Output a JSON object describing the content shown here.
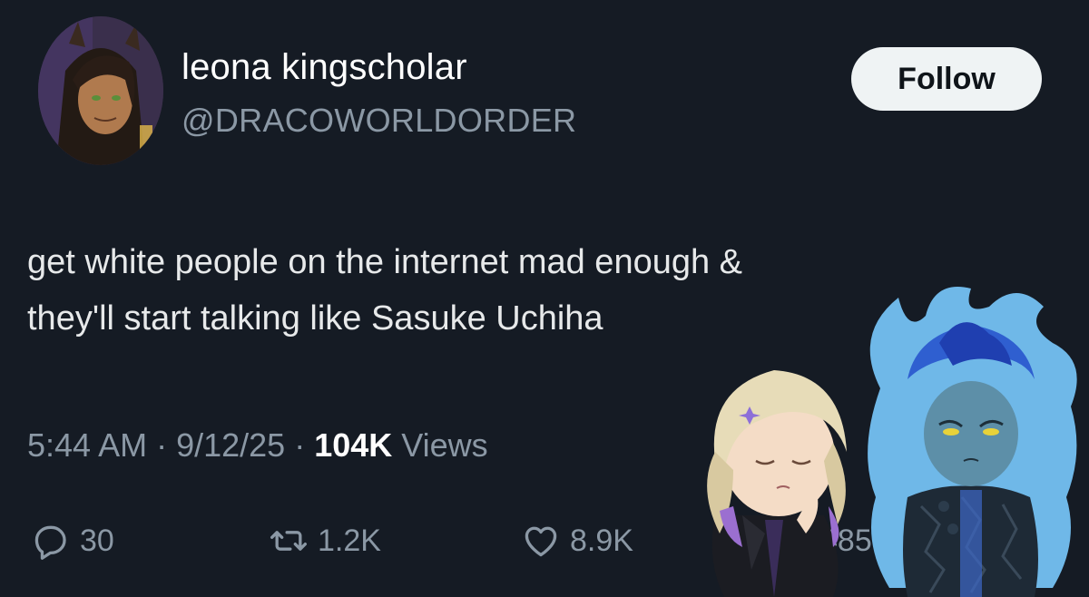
{
  "user": {
    "display_name": "leona kingscholar",
    "handle": "@DRACOWORLDORDER",
    "avatar_icon": "avatar-illustration"
  },
  "follow_label": "Follow",
  "tweet": {
    "line1": "get white people on the internet mad enough &",
    "line2": "they'll start talking like Sasuke Uchiha"
  },
  "meta": {
    "time": "5:44 AM",
    "sep1": " · ",
    "date": "9/12/25",
    "sep2": " · ",
    "views_count": "104K",
    "views_label": " Views"
  },
  "actions": {
    "replies": "30",
    "reposts": "1.2K",
    "likes": "8.9K",
    "bookmarks": "485"
  },
  "colors": {
    "background": "#151b24",
    "text": "#e7e9ea",
    "muted": "#8b98a5",
    "button_bg": "#eff3f4"
  }
}
